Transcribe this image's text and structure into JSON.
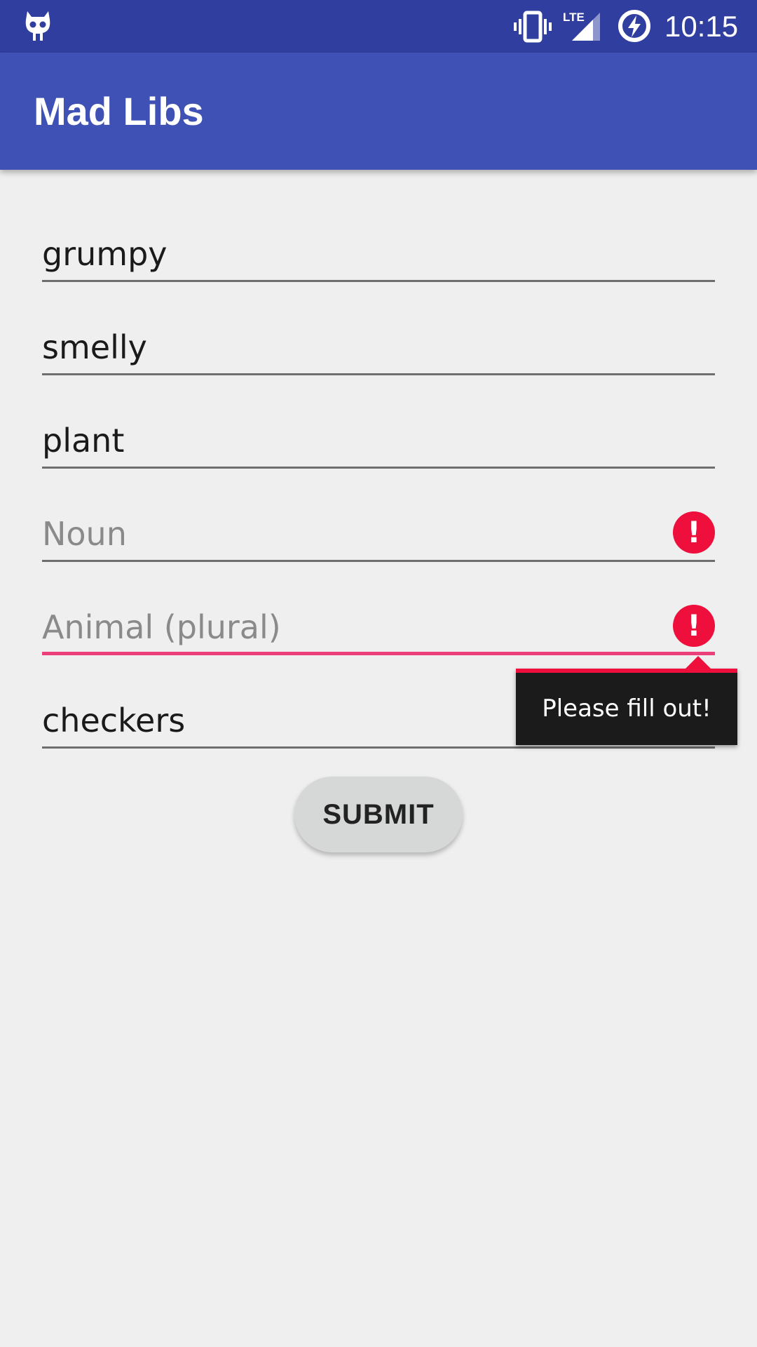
{
  "status_bar": {
    "time": "10:15",
    "network_label": "LTE",
    "icons": [
      "robot-icon",
      "vibrate-icon",
      "lte-signal-icon",
      "battery-charging-icon"
    ]
  },
  "app_bar": {
    "title": "Mad Libs"
  },
  "form": {
    "fields": [
      {
        "value": "grumpy",
        "placeholder": ""
      },
      {
        "value": "smelly",
        "placeholder": ""
      },
      {
        "value": "plant",
        "placeholder": ""
      },
      {
        "value": "",
        "placeholder": "Noun",
        "error": true
      },
      {
        "value": "",
        "placeholder": "Animal (plural)",
        "error": true,
        "focused": true
      },
      {
        "value": "checkers",
        "placeholder": ""
      }
    ],
    "error_icon_glyph": "!",
    "error_message": "Please fill out!",
    "submit_label": "SUBMIT"
  },
  "colors": {
    "status_bar": "#303f9f",
    "app_bar": "#3f51b5",
    "background": "#efefef",
    "error": "#ee0f3c",
    "focus_underline": "#ec407a",
    "button": "#d6d7d7"
  }
}
